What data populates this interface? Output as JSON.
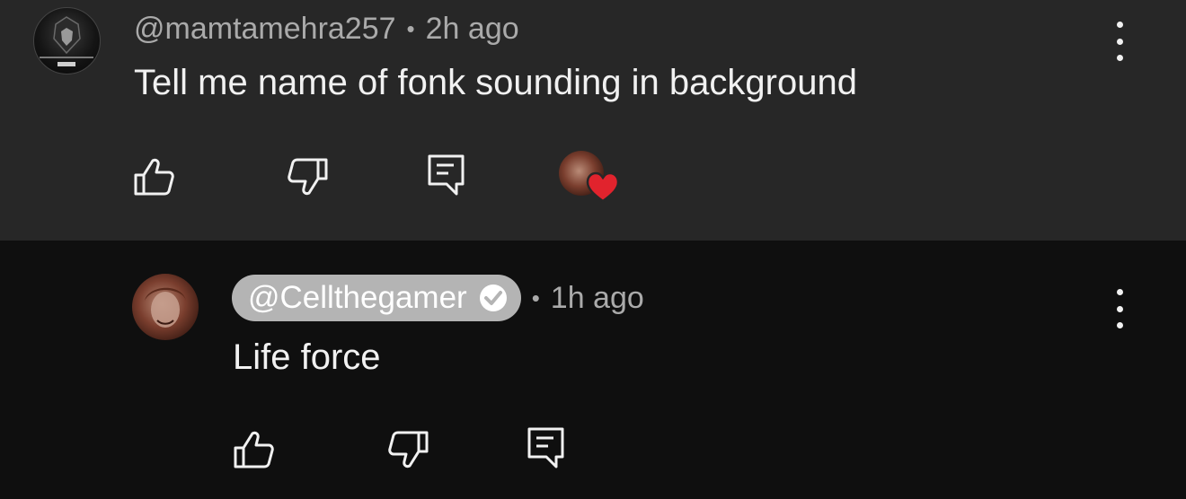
{
  "comments": [
    {
      "author": "@mamtamehra257",
      "separator": "•",
      "time": "2h ago",
      "text": "Tell me name of fonk sounding in background"
    },
    {
      "author": "@Cellthegamer",
      "separator": "•",
      "time": "1h ago",
      "text": "Life force"
    }
  ],
  "icons": {
    "like": "thumbs-up-icon",
    "dislike": "thumbs-down-icon",
    "reply": "comment-reply-icon",
    "menu": "more-vertical-icon",
    "verified": "verified-check-icon",
    "heart": "creator-heart-icon"
  },
  "colors": {
    "top_background": "#272727",
    "reply_background": "#0f0f0f",
    "chip_background": "#b4b4b4",
    "heart": "#e1232d"
  }
}
